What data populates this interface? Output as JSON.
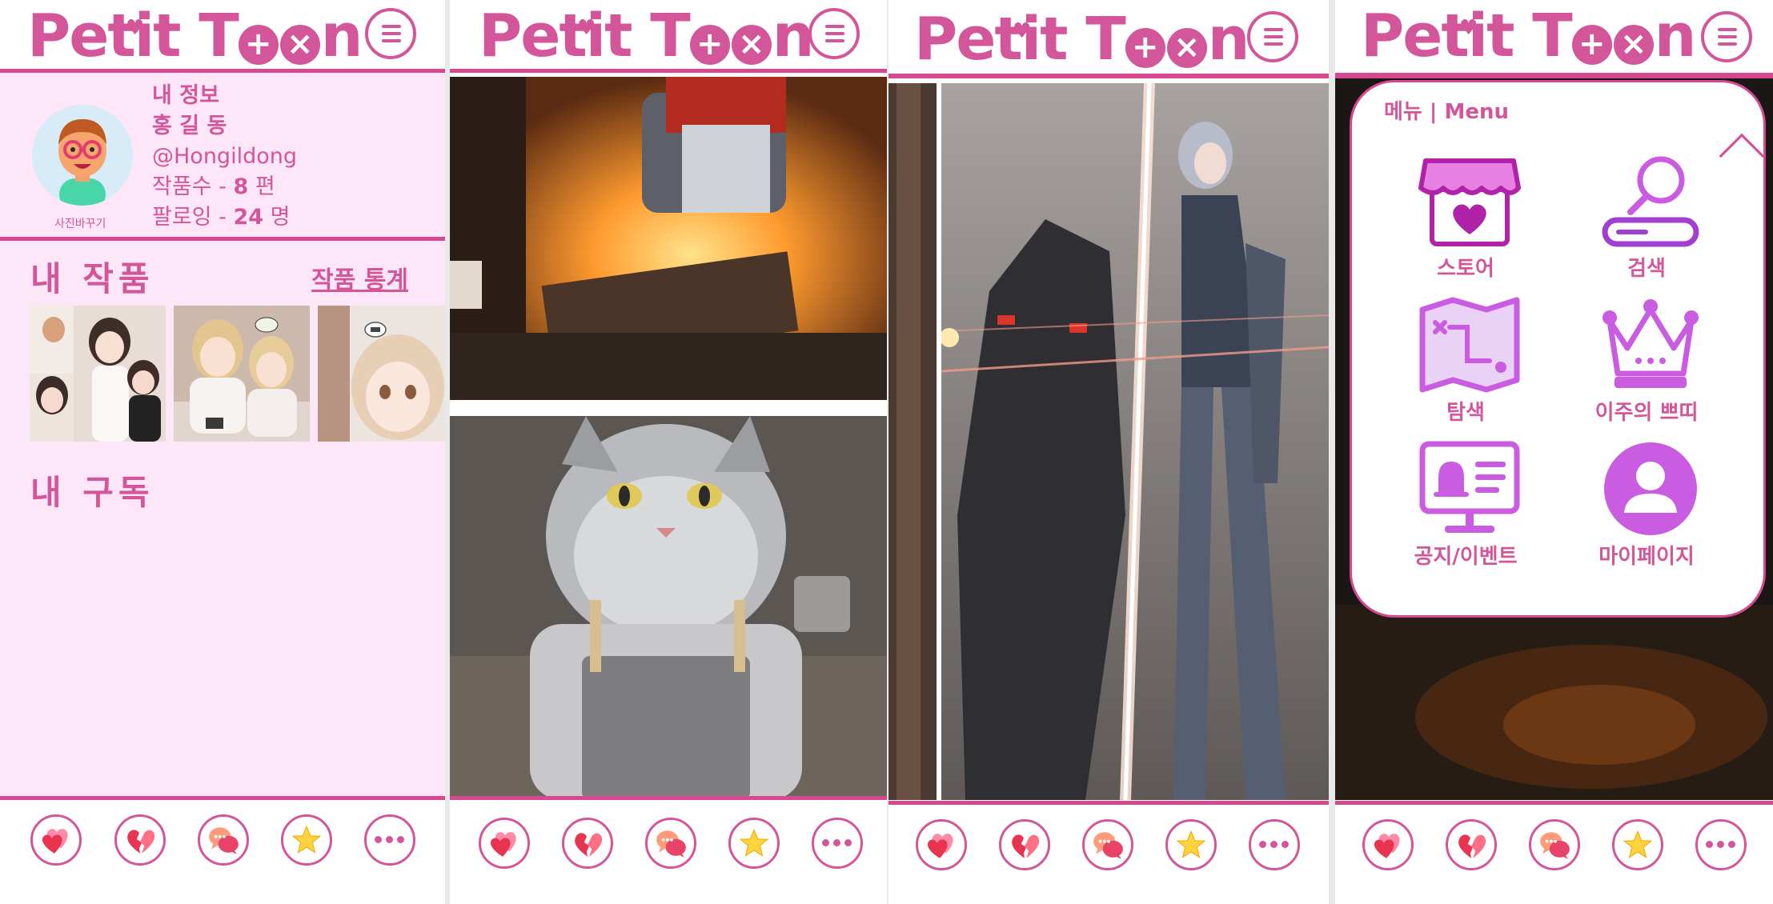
{
  "app": {
    "name_part1": "Petit T",
    "name_part2": "n"
  },
  "profile": {
    "heading": "내 정보",
    "name": "홍 길 동",
    "handle": "@Hongildong",
    "works_label": "작품수 - ",
    "works_count": "8",
    "works_unit": " 편",
    "following_label": "팔로잉 - ",
    "following_count": "24",
    "following_unit": " 명",
    "photo_change": "사진바꾸기"
  },
  "sections": {
    "my_works": "내 작품",
    "stats_link": "작품 통계",
    "my_subscriptions": "내 구독"
  },
  "popup": {
    "title": "메뉴 | Menu",
    "items": [
      {
        "label": "스토어",
        "icon": "store-icon"
      },
      {
        "label": "검색",
        "icon": "search-icon"
      },
      {
        "label": "탐색",
        "icon": "map-icon"
      },
      {
        "label": "이주의 쁘띠",
        "icon": "crown-icon"
      },
      {
        "label": "공지/이벤트",
        "icon": "notice-board-icon"
      },
      {
        "label": "마이페이지",
        "icon": "user-icon"
      }
    ]
  },
  "bottom_nav": [
    {
      "icon": "hearts-icon"
    },
    {
      "icon": "broken-heart-icon"
    },
    {
      "icon": "chat-bubbles-icon"
    },
    {
      "icon": "star-icon"
    },
    {
      "icon": "more-icon"
    }
  ],
  "colors": {
    "brand": "#d4569a",
    "accent_line": "#d6488f",
    "profile_bg": "#fde6f8",
    "menu_icon": "#c95ce0"
  }
}
